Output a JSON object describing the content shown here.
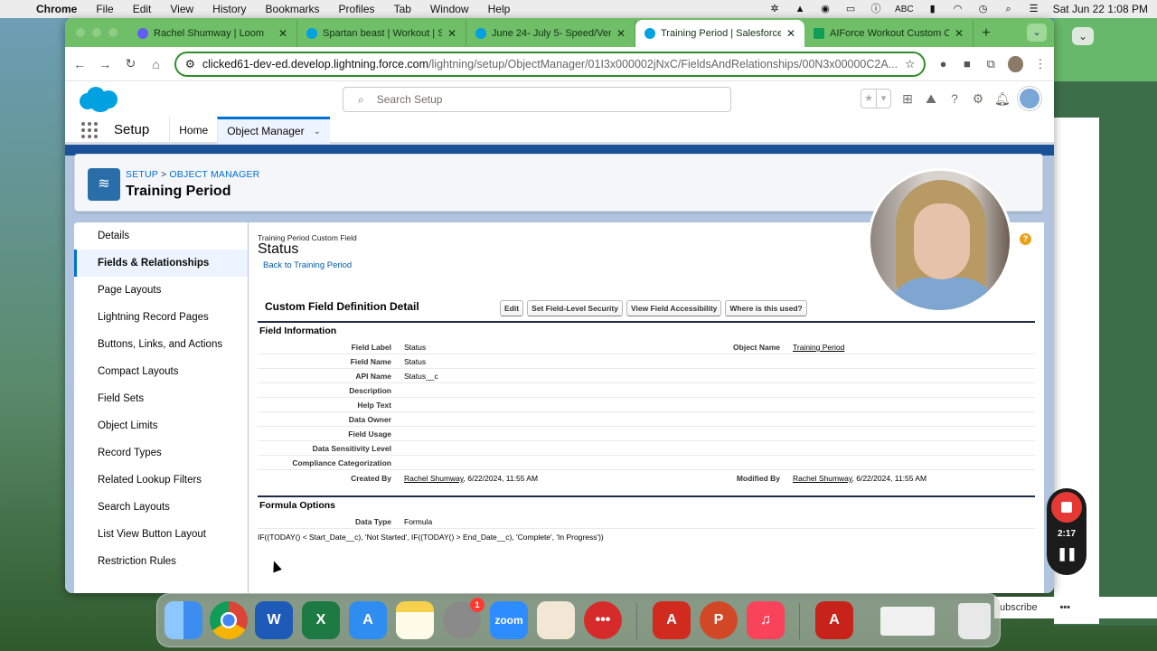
{
  "menubar": {
    "app_name": "Chrome",
    "items": [
      "File",
      "Edit",
      "View",
      "History",
      "Bookmarks",
      "Profiles",
      "Tab",
      "Window",
      "Help"
    ],
    "input_source": "ABC",
    "datetime": "Sat Jun 22  1:08 PM"
  },
  "browser": {
    "tabs": [
      {
        "title": "Rachel Shumway | Loom",
        "color": "#625df5"
      },
      {
        "title": "Spartan beast | Workout | Sa",
        "color": "#00a1e0"
      },
      {
        "title": "June 24- July 5- Speed/Vert",
        "color": "#00a1e0"
      },
      {
        "title": "Training Period | Salesforce",
        "color": "#00a1e0"
      },
      {
        "title": "AIForce Workout Custom Ob",
        "color": "#0f9d58"
      }
    ],
    "url_host": "clicked61-dev-ed.develop.lightning.force.com",
    "url_path": "/lightning/setup/ObjectManager/01I3x000002jNxC/FieldsAndRelationships/00N3x00000C2A..."
  },
  "sf": {
    "search_placeholder": "Search Setup",
    "app_name": "Setup",
    "nav_home": "Home",
    "nav_object_manager": "Object Manager",
    "breadcrumb_setup": "SETUP",
    "breadcrumb_sep": ">",
    "breadcrumb_om": "OBJECT MANAGER",
    "page_title": "Training Period",
    "left_nav": [
      "Details",
      "Fields & Relationships",
      "Page Layouts",
      "Lightning Record Pages",
      "Buttons, Links, and Actions",
      "Compact Layouts",
      "Field Sets",
      "Object Limits",
      "Record Types",
      "Related Lookup Filters",
      "Search Layouts",
      "List View Button Layout",
      "Restriction Rules"
    ],
    "field": {
      "subtitle": "Training Period Custom Field",
      "title": "Status",
      "back_link": "Back to Training Period",
      "section_title": "Custom Field Definition Detail",
      "buttons": [
        "Edit",
        "Set Field-Level Security",
        "View Field Accessibility",
        "Where is this used?"
      ],
      "info_header": "Field Information",
      "label_field_label": "Field Label",
      "value_field_label": "Status",
      "label_object_name": "Object Name",
      "value_object_name": "Training Period",
      "label_field_name": "Field Name",
      "value_field_name": "Status",
      "label_api_name": "API Name",
      "value_api_name": "Status__c",
      "label_description": "Description",
      "label_help_text": "Help Text",
      "label_data_owner": "Data Owner",
      "label_field_usage": "Field Usage",
      "label_sensitivity": "Data Sensitivity Level",
      "label_compliance": "Compliance Categorization",
      "label_created_by": "Created By",
      "value_created_by_user": "Rachel Shumway",
      "value_created_by_date": ", 6/22/2024, 11:55 AM",
      "label_modified_by": "Modified By",
      "value_modified_by_user": "Rachel Shumway",
      "value_modified_by_date": ", 6/22/2024, 11:55 AM",
      "formula_header": "Formula Options",
      "label_data_type": "Data Type",
      "value_data_type": "Formula",
      "formula": "IF((TODAY() < Start_Date__c), 'Not Started', IF((TODAY() > End_Date__c), 'Complete', 'In Progress'))"
    }
  },
  "loom": {
    "elapsed": "2:17"
  },
  "dock": {
    "apps": [
      {
        "name": "Finder",
        "label": "",
        "color": "#3d8df0"
      },
      {
        "name": "Chrome",
        "label": "",
        "color": "#ffffff"
      },
      {
        "name": "Word",
        "label": "W",
        "color": "#1e5bb8"
      },
      {
        "name": "Excel",
        "label": "X",
        "color": "#1d7a43"
      },
      {
        "name": "App Store",
        "label": "A",
        "color": "#2f8cf0"
      },
      {
        "name": "Notes",
        "label": "",
        "color": "#f6d04d"
      },
      {
        "name": "System Settings",
        "label": "",
        "color": "#8a8a8a"
      },
      {
        "name": "Zoom",
        "label": "zoom",
        "color": "#2d8cff"
      },
      {
        "name": "Bowl",
        "label": "",
        "color": "#f2e6d4"
      },
      {
        "name": "Dots",
        "label": "•••",
        "color": "#d62b2b"
      },
      {
        "name": "Acrobat",
        "label": "A",
        "color": "#d12b20"
      },
      {
        "name": "PowerPoint",
        "label": "P",
        "color": "#d24726"
      },
      {
        "name": "Music",
        "label": "♫",
        "color": "#f9435a"
      },
      {
        "name": "Acrobat2",
        "label": "A",
        "color": "#c8231b"
      }
    ],
    "settings_badge": "1"
  },
  "behind": {
    "subscribe_text": "ubscribe",
    "more": "•••"
  }
}
